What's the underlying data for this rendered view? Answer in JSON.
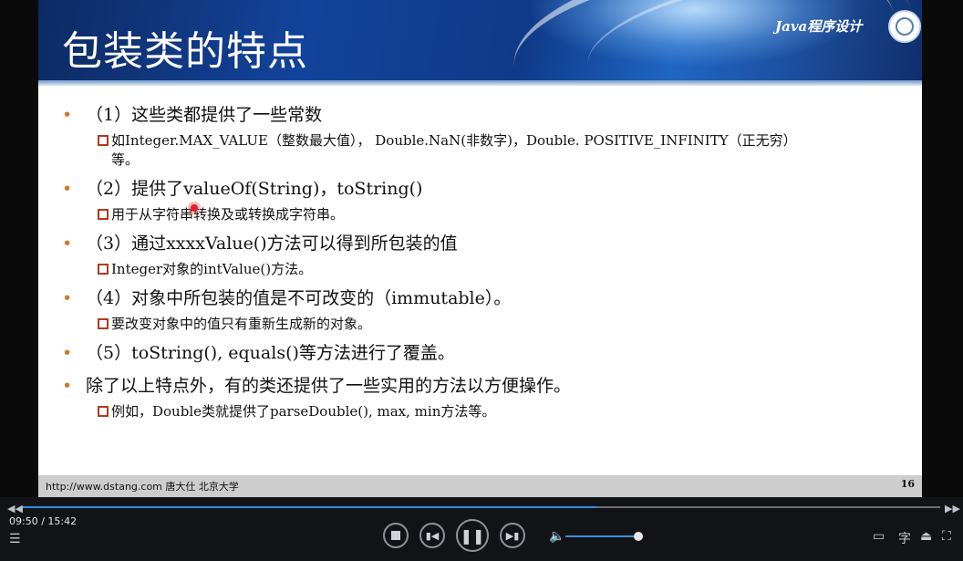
{
  "slide": {
    "title": "包装类的特点",
    "course": "Java程序设计",
    "items": [
      {
        "text": "（1）这些类都提供了一些常数",
        "subs": [
          "如Integer.MAX_VALUE（整数最大值）， Double.NaN(非数字)，Double. POSITIVE_INFINITY（正无穷）",
          "等。"
        ]
      },
      {
        "text": "（2）提供了valueOf(String)，toString()",
        "subs": [
          "用于从字符串转换及或转换成字符串。"
        ]
      },
      {
        "text": "（3）通过xxxxValue()方法可以得到所包装的值",
        "subs": [
          "Integer对象的intValue()方法。"
        ]
      },
      {
        "text": "（4）对象中所包装的值是不可改变的（immutable）。",
        "subs": [
          "要改变对象中的值只有重新生成新的对象。"
        ]
      },
      {
        "text": "（5）toString(), equals()等方法进行了覆盖。",
        "subs": []
      },
      {
        "text": "除了以上特点外，有的类还提供了一些实用的方法以方便操作。",
        "subs": [
          "例如，Double类就提供了parseDouble(), max, min方法等。"
        ]
      }
    ],
    "footer_url": "http://www.dstang.com 唐大仕 北京大学",
    "page_number": "16"
  },
  "player": {
    "current_time": "09:50",
    "separator": " / ",
    "total_time": "15:42",
    "progress_fraction": 0.625,
    "volume_fraction": 0.95,
    "accent_color": "#2e8ee6"
  }
}
